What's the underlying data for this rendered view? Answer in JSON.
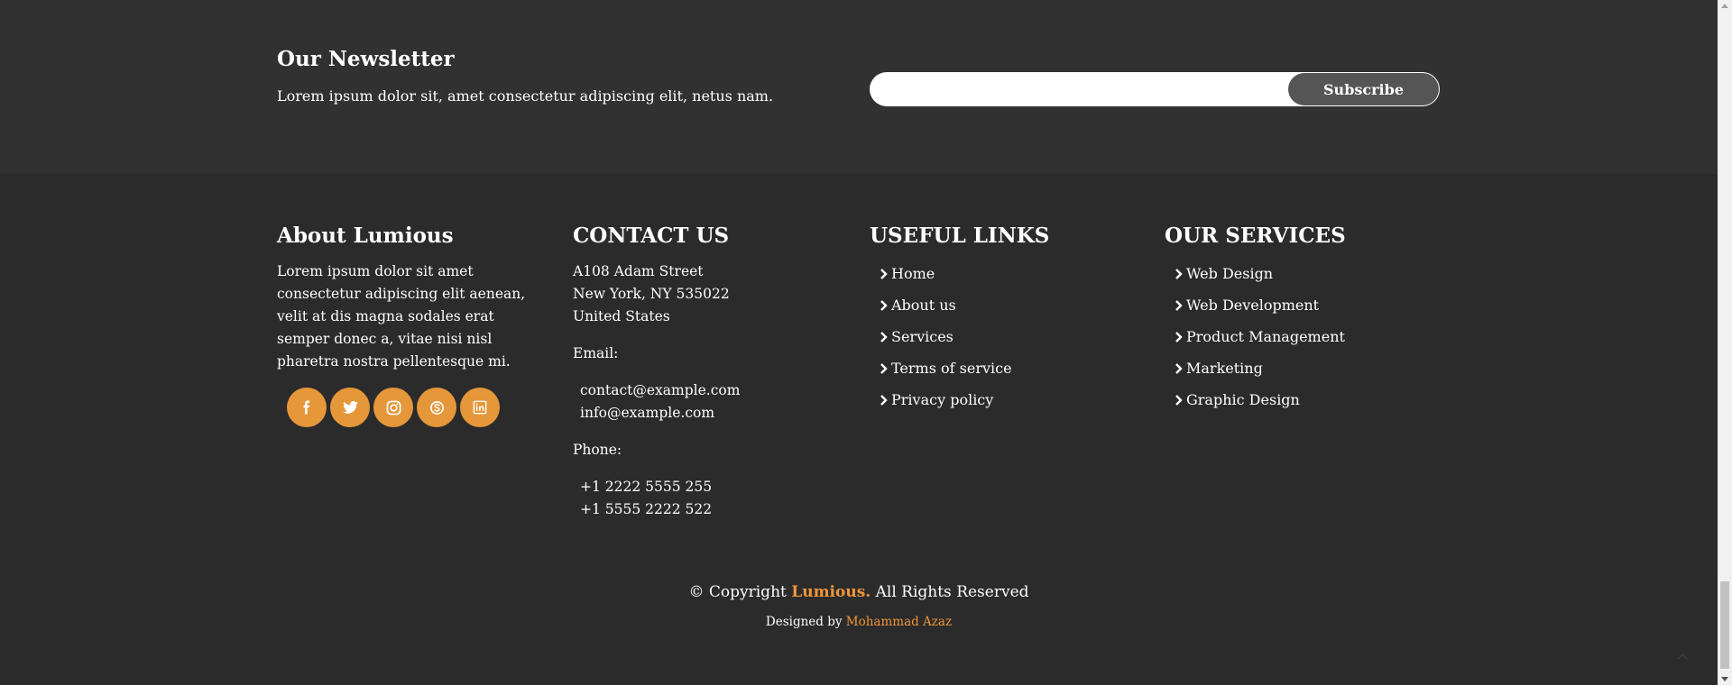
{
  "newsletter": {
    "title": "Our Newsletter",
    "text": "Lorem ipsum dolor sit, amet consectetur adipiscing elit, netus nam.",
    "input_value": "",
    "button_label": "Subscribe"
  },
  "about": {
    "title": "About Lumious",
    "text": "Lorem ipsum dolor sit amet consectetur adipiscing elit aenean, velit at dis magna sodales erat semper donec a, vitae nisi nisl pharetra nostra pellentesque mi.",
    "social": [
      "facebook-icon",
      "twitter-icon",
      "instagram-icon",
      "skype-icon",
      "linkedin-icon"
    ]
  },
  "contact": {
    "title": "CONTACT US",
    "address": [
      "A108 Adam Street",
      "New York, NY 535022",
      "United States"
    ],
    "email_label": "Email:",
    "emails": [
      "contact@example.com",
      "info@example.com"
    ],
    "phone_label": "Phone:",
    "phones": [
      "+1 2222 5555 255",
      "+1 5555 2222 522"
    ]
  },
  "links": {
    "title": "USEFUL LINKS",
    "items": [
      {
        "label": "Home"
      },
      {
        "label": "About us"
      },
      {
        "label": "Services"
      },
      {
        "label": "Terms of service"
      },
      {
        "label": "Privacy policy"
      }
    ]
  },
  "services": {
    "title": "OUR SERVICES",
    "items": [
      {
        "label": "Web Design"
      },
      {
        "label": "Web Development"
      },
      {
        "label": "Product Management"
      },
      {
        "label": "Marketing"
      },
      {
        "label": "Graphic Design"
      }
    ]
  },
  "footer": {
    "copyright_prefix": "© Copyright ",
    "brand": "Lumious.",
    "copyright_suffix": " All Rights Reserved",
    "designed_prefix": "Designed by ",
    "designer": "Mohammad Azaz"
  },
  "colors": {
    "background": "#2b2b2b",
    "newsletter_background": "#313131",
    "accent": "#e5973a",
    "button": "#555555"
  }
}
